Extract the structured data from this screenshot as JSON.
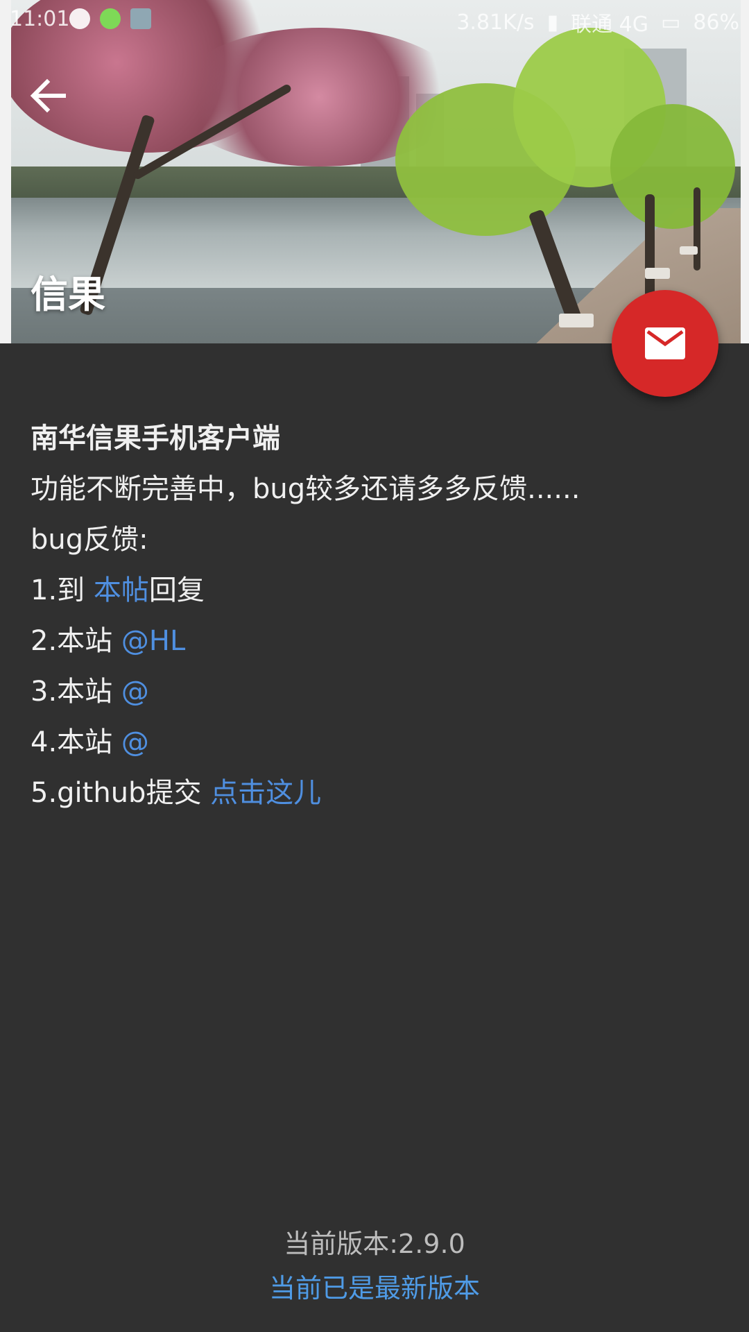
{
  "status_bar": {
    "time": "11:01",
    "net_speed": "3.81K/s",
    "carrier": "联通 4G",
    "battery": "86%"
  },
  "toolbar": {
    "title": "信果"
  },
  "content": {
    "headline": "南华信果手机客户端",
    "line1": "功能不断完善中，bug较多还请多多反馈......",
    "line2": "bug反馈:",
    "items": [
      {
        "prefix": "1.到 ",
        "link": "本帖",
        "suffix": "回复"
      },
      {
        "prefix": "2.本站 ",
        "link": "@HL",
        "suffix": ""
      },
      {
        "prefix": "3.本站 ",
        "link": "@",
        "suffix": ""
      },
      {
        "prefix": "4.本站 ",
        "link": "@",
        "suffix": ""
      },
      {
        "prefix": "5.github提交 ",
        "link": "点击这儿",
        "suffix": ""
      }
    ]
  },
  "footer": {
    "version": "当前版本:2.9.0",
    "update_status": "当前已是最新版本"
  },
  "colors": {
    "background": "#303030",
    "fab": "#d62828",
    "link": "#4f8fe0"
  }
}
